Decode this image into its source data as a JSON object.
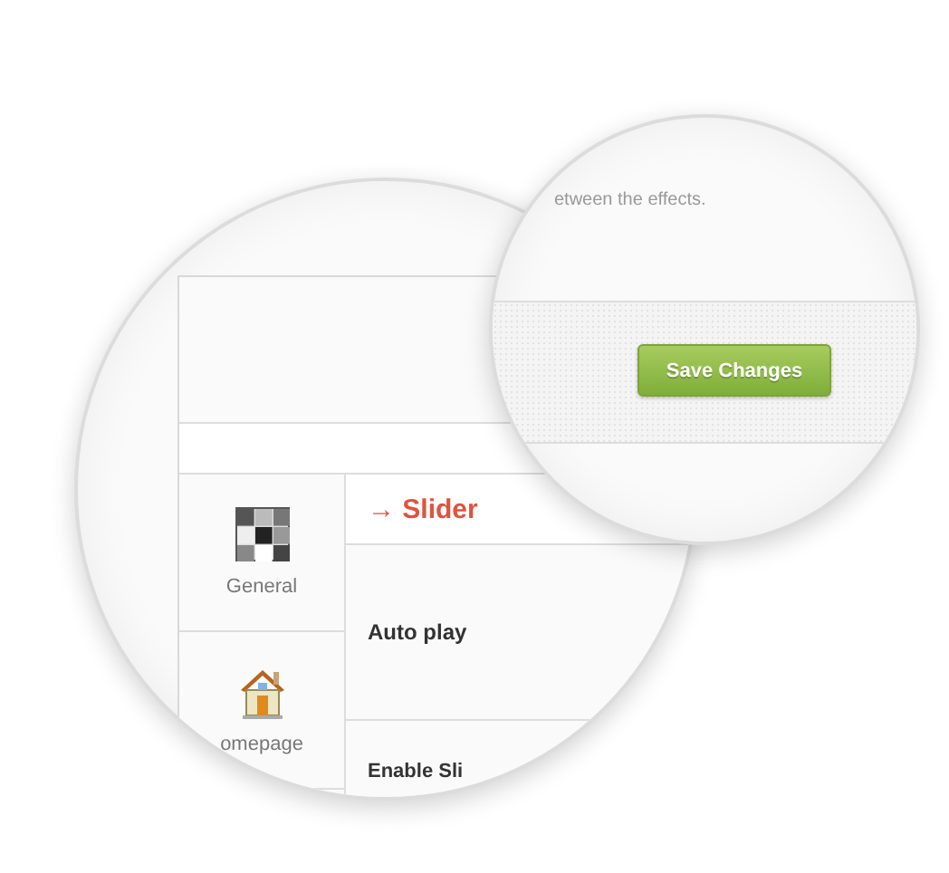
{
  "settings_panel": {
    "sidebar": {
      "items": [
        {
          "kind": "general",
          "label": "General"
        },
        {
          "kind": "homepage",
          "label": "omepage"
        }
      ]
    },
    "section_title": "→ Slider",
    "options": [
      {
        "label": "Auto play"
      },
      {
        "label": "Enable Sli"
      }
    ]
  },
  "save_bar": {
    "description": "etween the effects.",
    "save_button": "Save Changes"
  }
}
